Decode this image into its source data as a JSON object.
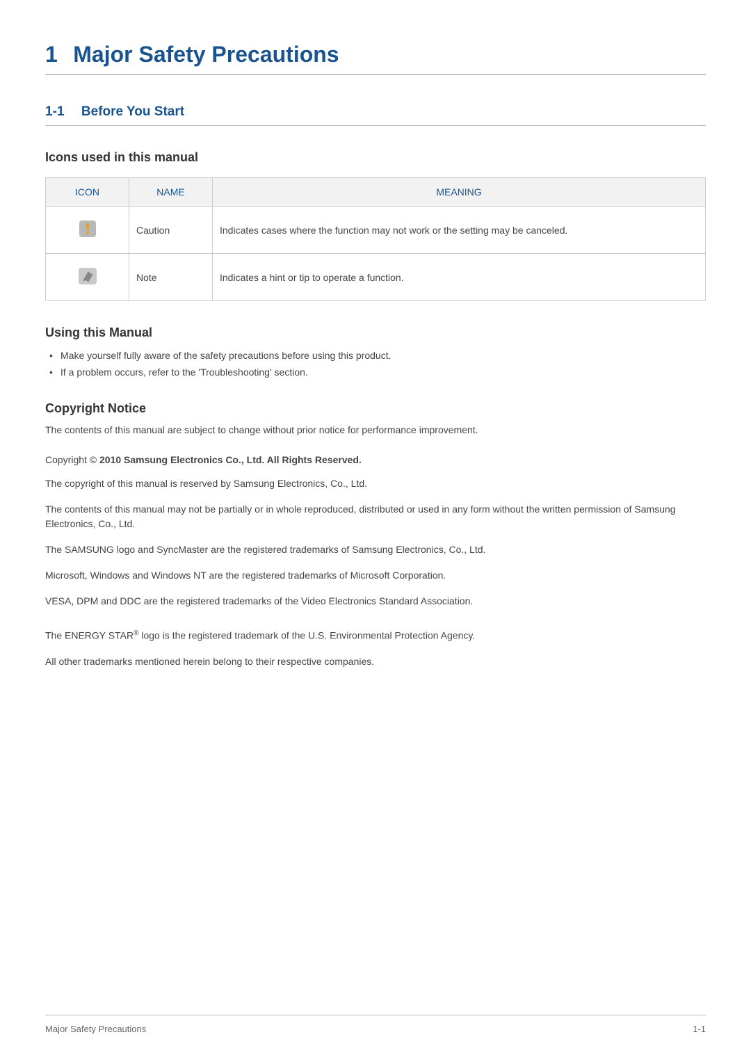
{
  "chapter": {
    "number": "1",
    "title": "Major Safety Precautions"
  },
  "section": {
    "number": "1-1",
    "title": "Before You Start"
  },
  "icons_heading": "Icons used in this manual",
  "table": {
    "headers": {
      "icon": "ICON",
      "name": "NAME",
      "meaning": "MEANING"
    },
    "rows": [
      {
        "name": "Caution",
        "meaning": "Indicates cases where the function may not work or the setting may be canceled."
      },
      {
        "name": "Note",
        "meaning": "Indicates a hint or tip to operate a function."
      }
    ]
  },
  "using_heading": "Using this Manual",
  "using_bullets": [
    "Make yourself fully aware of the safety precautions before using this product.",
    "If a problem occurs, refer to the 'Troubleshooting' section."
  ],
  "copyright_heading": "Copyright Notice",
  "copyright_intro": "The contents of this manual are subject to change without prior notice for performance improvement.",
  "copyright_prefix": "Copyright © ",
  "copyright_bold": "2010 Samsung Electronics Co., Ltd. All Rights Reserved.",
  "copyright_paras": [
    "The copyright of this manual is reserved by Samsung Electronics, Co., Ltd.",
    "The contents of this manual may not be partially or in whole reproduced, distributed or used in any form without the written permission of Samsung Electronics, Co., Ltd.",
    "The SAMSUNG logo and SyncMaster are the registered trademarks of Samsung Electronics, Co., Ltd.",
    "Microsoft, Windows and Windows NT are the registered trademarks of Microsoft Corporation.",
    "VESA, DPM and DDC are the registered trademarks of the Video Electronics Standard Association."
  ],
  "energy_star_prefix": "The ENERGY STAR",
  "energy_star_sup": "®",
  "energy_star_suffix": " logo is the registered trademark of the U.S. Environmental Protection Agency.",
  "trademarks_final": "All other trademarks mentioned herein belong to their respective companies.",
  "footer": {
    "left": "Major Safety Precautions",
    "right": "1-1"
  }
}
